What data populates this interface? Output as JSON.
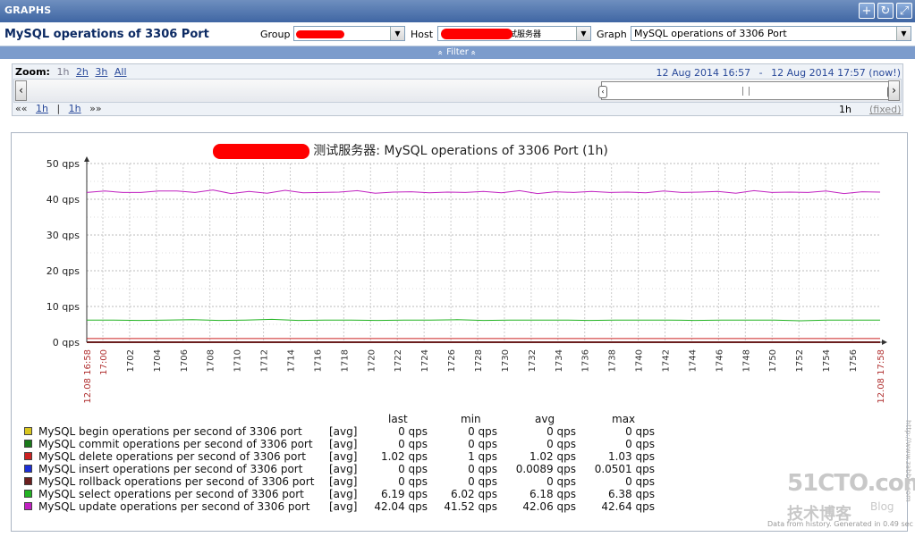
{
  "header": {
    "title": "GRAPHS"
  },
  "toolbar": {
    "page_title": "MySQL operations of 3306 Port",
    "group_label": "Group",
    "group_value": "",
    "host_label": "Host",
    "host_value": "测试服务器",
    "graph_label": "Graph",
    "graph_value": "MySQL operations of 3306 Port"
  },
  "filter": {
    "label": "Filter",
    "arrows": "»"
  },
  "zoom": {
    "label": "Zoom:",
    "options": [
      "1h",
      "2h",
      "3h",
      "All"
    ],
    "period_start": "12 Aug 2014 16:57",
    "separator": "-",
    "period_end": "12 Aug 2014 17:57 (now!)",
    "nav_back": "««",
    "nav_back_1h": "1h",
    "nav_sep": "|",
    "nav_fwd_1h": "1h",
    "nav_fwd": "»»",
    "period_text": "1h",
    "fixed_text": "(fixed)"
  },
  "chart_data": {
    "type": "line",
    "title": "测试服务器: MySQL operations of 3306 Port (1h)",
    "ylim": [
      0,
      50
    ],
    "y_ticks": [
      "50 qps",
      "40 qps",
      "30 qps",
      "20 qps",
      "10 qps",
      "0 qps"
    ],
    "x_start_label": "12.08 16:58",
    "x_end_label": "12.08 17:58",
    "x_tick_labels": [
      "17:00",
      "1702",
      "1704",
      "1706",
      "1708",
      "1710",
      "1712",
      "1714",
      "1716",
      "1718",
      "1720",
      "1722",
      "1724",
      "1726",
      "1728",
      "1730",
      "1732",
      "1734",
      "1736",
      "1738",
      "1740",
      "1742",
      "1744",
      "1746",
      "1748",
      "1750",
      "1752",
      "1754",
      "1756"
    ],
    "legend_header": {
      "last": "last",
      "min": "min",
      "avg": "avg",
      "max": "max"
    },
    "series": [
      {
        "name": "MySQL begin operations per second of 3306 port",
        "func": "[avg]",
        "color": "#d9c61f",
        "last": "0 qps",
        "min": "0 qps",
        "avg": "0 qps",
        "max": "0 qps",
        "values": [
          0,
          0,
          0,
          0,
          0,
          0,
          0,
          0,
          0,
          0,
          0,
          0,
          0,
          0,
          0,
          0,
          0,
          0,
          0,
          0,
          0,
          0,
          0,
          0,
          0,
          0,
          0,
          0,
          0,
          0,
          0
        ]
      },
      {
        "name": "MySQL commit operations per second of 3306 port",
        "func": "[avg]",
        "color": "#1a7a1a",
        "last": "0 qps",
        "min": "0 qps",
        "avg": "0 qps",
        "max": "0 qps",
        "values": [
          0,
          0,
          0,
          0,
          0,
          0,
          0,
          0,
          0,
          0,
          0,
          0,
          0,
          0,
          0,
          0,
          0,
          0,
          0,
          0,
          0,
          0,
          0,
          0,
          0,
          0,
          0,
          0,
          0,
          0,
          0
        ]
      },
      {
        "name": "MySQL delete operations per second of 3306 port",
        "func": "[avg]",
        "color": "#cc2222",
        "last": "1.02 qps",
        "min": "1 qps",
        "avg": "1.02 qps",
        "max": "1.03 qps",
        "values": [
          1.02,
          1.02,
          1.02,
          1.02,
          1.02,
          1.02,
          1.02,
          1.02,
          1.02,
          1.02,
          1.02,
          1.02,
          1.02,
          1.02,
          1.02,
          1.02,
          1.02,
          1.02,
          1.02,
          1.02,
          1.02,
          1.02,
          1.02,
          1.02,
          1.02,
          1.02,
          1.02,
          1.02,
          1.02,
          1.02,
          1.02
        ]
      },
      {
        "name": "MySQL insert operations per second of 3306 port",
        "func": "[avg]",
        "color": "#1c2fd6",
        "last": "0 qps",
        "min": "0 qps",
        "avg": "0.0089 qps",
        "max": "0.0501 qps",
        "values": [
          0,
          0,
          0,
          0,
          0,
          0,
          0,
          0,
          0,
          0,
          0,
          0,
          0,
          0,
          0,
          0,
          0,
          0,
          0,
          0,
          0,
          0,
          0,
          0,
          0,
          0,
          0,
          0,
          0,
          0,
          0
        ]
      },
      {
        "name": "MySQL rollback operations per second of 3306 port",
        "func": "[avg]",
        "color": "#6b1f1f",
        "last": "0 qps",
        "min": "0 qps",
        "avg": "0 qps",
        "max": "0 qps",
        "values": [
          0,
          0,
          0,
          0,
          0,
          0,
          0,
          0,
          0,
          0,
          0,
          0,
          0,
          0,
          0,
          0,
          0,
          0,
          0,
          0,
          0,
          0,
          0,
          0,
          0,
          0,
          0,
          0,
          0,
          0,
          0
        ]
      },
      {
        "name": "MySQL select operations per second of 3306 port",
        "func": "[avg]",
        "color": "#22b322",
        "last": "6.19 qps",
        "min": "6.02 qps",
        "avg": "6.18 qps",
        "max": "6.38 qps",
        "values": [
          6.2,
          6.2,
          6.1,
          6.2,
          6.3,
          6.1,
          6.2,
          6.4,
          6.1,
          6.2,
          6.2,
          6.1,
          6.2,
          6.2,
          6.3,
          6.1,
          6.2,
          6.2,
          6.2,
          6.1,
          6.2,
          6.2,
          6.2,
          6.1,
          6.2,
          6.2,
          6.2,
          6.0,
          6.2,
          6.2,
          6.2
        ]
      },
      {
        "name": "MySQL update operations per second of 3306 port",
        "func": "[avg]",
        "color": "#c020c0",
        "last": "42.04 qps",
        "min": "41.52 qps",
        "avg": "42.06 qps",
        "max": "42.64 qps",
        "values": [
          41.9,
          42.3,
          41.9,
          41.9,
          42.3,
          42.3,
          41.9,
          42.6,
          41.6,
          42.2,
          41.7,
          42.5,
          41.8,
          41.9,
          42.0,
          42.4,
          41.7,
          42.0,
          42.1,
          41.8,
          42.0,
          41.9,
          42.2,
          41.8,
          42.4,
          41.6,
          42.1,
          41.9,
          42.2,
          41.9,
          42.0,
          41.8,
          42.3,
          41.9,
          42.0,
          42.2,
          41.7,
          42.4,
          41.9,
          42.0,
          41.9,
          42.3,
          41.6,
          42.1,
          42.0
        ]
      }
    ]
  },
  "watermark": {
    "site": "51CTO.com",
    "blog": "技术博客",
    "blog_en": "Blog",
    "footer": "Data from history. Generated in 0.49 sec",
    "zabbix_vertical": "http://www.zabbix.com"
  }
}
